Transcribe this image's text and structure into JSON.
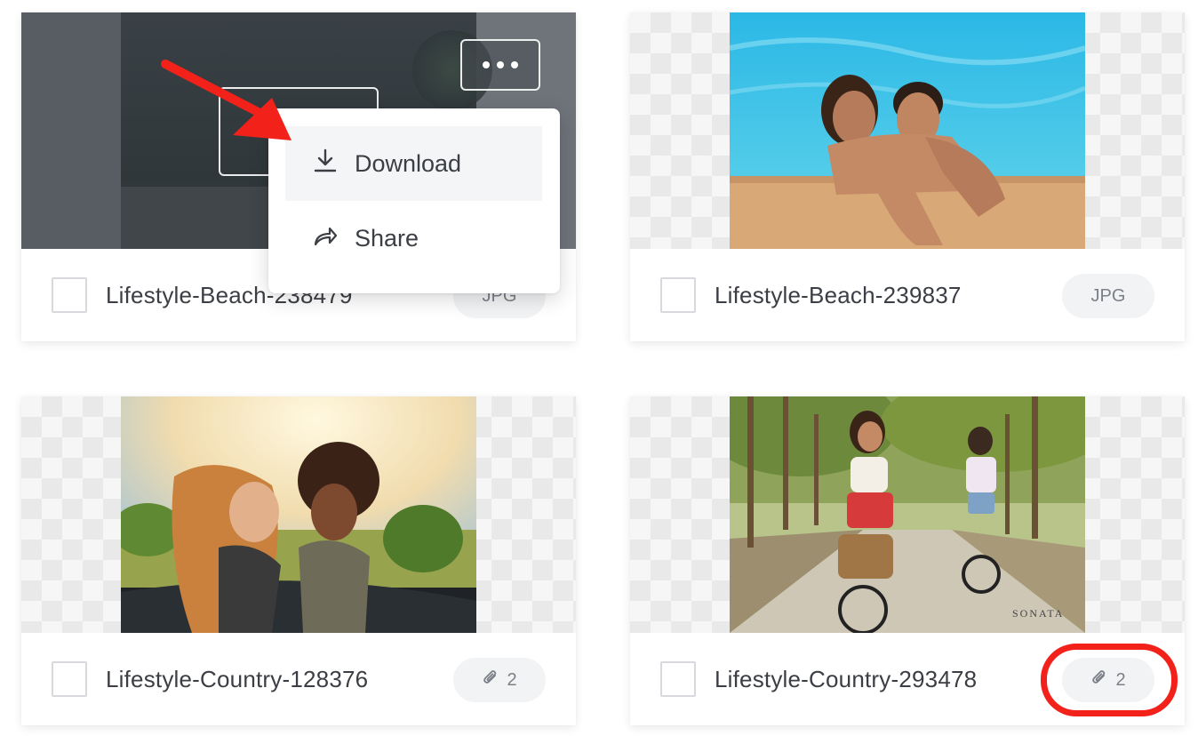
{
  "cards": [
    {
      "filename": "Lifestyle-Beach-238479",
      "badge": {
        "icon": "",
        "text": "JPG"
      }
    },
    {
      "filename": "Lifestyle-Beach-239837",
      "badge": {
        "icon": "",
        "text": "JPG"
      }
    },
    {
      "filename": "Lifestyle-Country-128376",
      "badge": {
        "icon": "paperclip-icon",
        "text": "2"
      }
    },
    {
      "filename": "Lifestyle-Country-293478",
      "badge": {
        "icon": "paperclip-icon",
        "text": "2"
      }
    }
  ],
  "photo_watermark": "SONATA",
  "menu": {
    "download_label": "Download",
    "share_label": "Share"
  },
  "annotation_color": "#f2221b"
}
